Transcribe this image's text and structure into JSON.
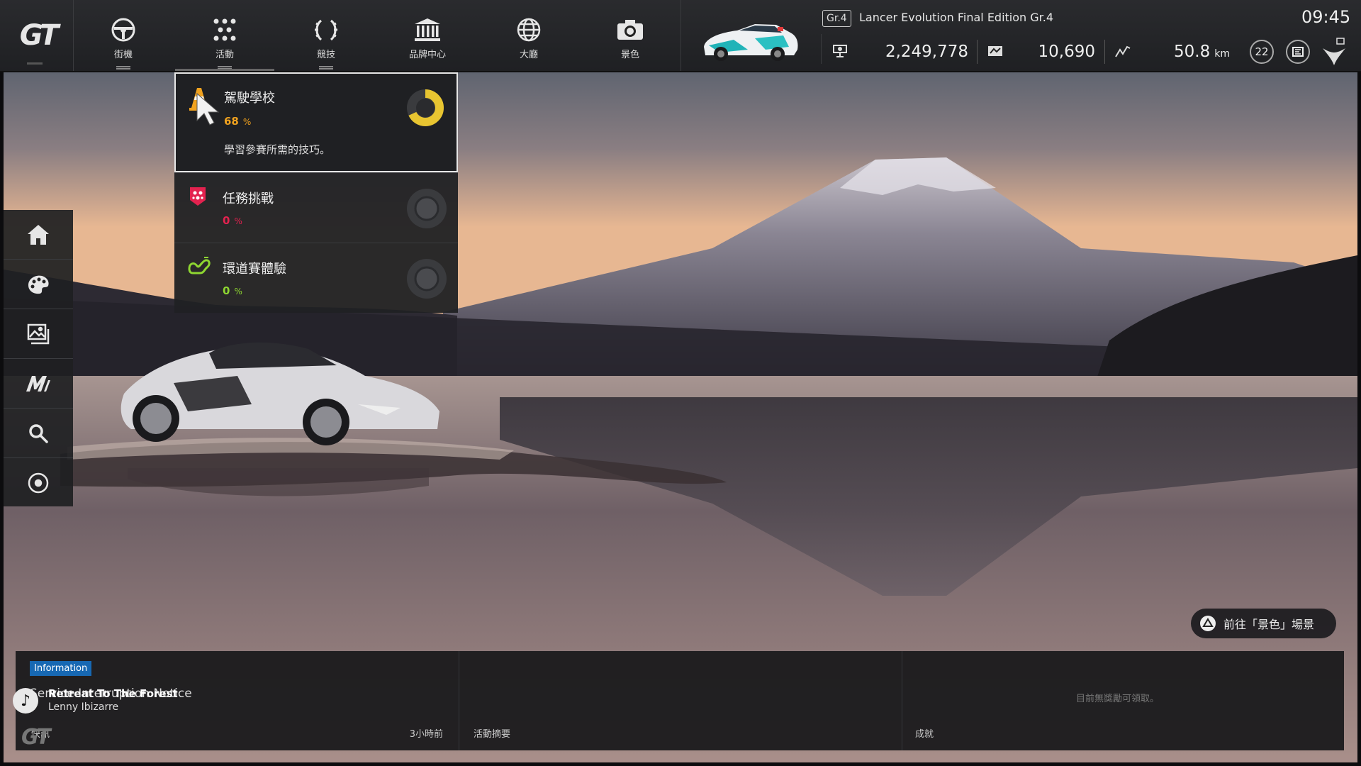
{
  "topbar": {
    "nav": [
      {
        "label": "街機",
        "icon": "steering-wheel-icon"
      },
      {
        "label": "活動",
        "icon": "dots-grid-icon"
      },
      {
        "label": "競技",
        "icon": "laurel-icon"
      },
      {
        "label": "品牌中心",
        "icon": "building-icon"
      },
      {
        "label": "大廳",
        "icon": "globe-icon"
      },
      {
        "label": "景色",
        "icon": "camera-icon"
      }
    ],
    "car": {
      "class_badge": "Gr.4",
      "name": "Lancer Evolution Final Edition Gr.4"
    },
    "clock": "09:45",
    "stats": {
      "credits": "2,249,778",
      "mileage_points": "10,690",
      "distance": "50.8",
      "distance_unit": "km",
      "level": "22"
    }
  },
  "menu": {
    "items": [
      {
        "title": "駕駛學校",
        "percent": "68",
        "percent_sign": "%",
        "description": "學習參賽所需的技巧。",
        "progress": 0.68,
        "color": "#f0a21f",
        "ring_color": "#e8c531"
      },
      {
        "title": "任務挑戰",
        "percent": "0",
        "percent_sign": "%",
        "progress": 0,
        "color": "#e3224f"
      },
      {
        "title": "環道賽體驗",
        "percent": "0",
        "percent_sign": "%",
        "progress": 0,
        "color": "#8ed631"
      }
    ]
  },
  "sidebar": {
    "icons": [
      "home-icon",
      "palette-icon",
      "gallery-icon",
      "m-logo-icon",
      "search-icon",
      "settings-circle-icon"
    ]
  },
  "hint": {
    "text": "前往「景色」場景"
  },
  "bottom": {
    "badge": "Information",
    "notice": "Service Interruption Notice",
    "news_label": "快訊",
    "time_ago": "3小時前",
    "activity_label": "活動摘要",
    "achievement_label": "成就",
    "no_reward": "目前無獎勵可領取。"
  },
  "music": {
    "song": "Retreat To The Forest",
    "artist": "Lenny Ibizarre"
  },
  "colors": {
    "accent_blue": "#1768b3",
    "menu_bg": "#202124"
  }
}
